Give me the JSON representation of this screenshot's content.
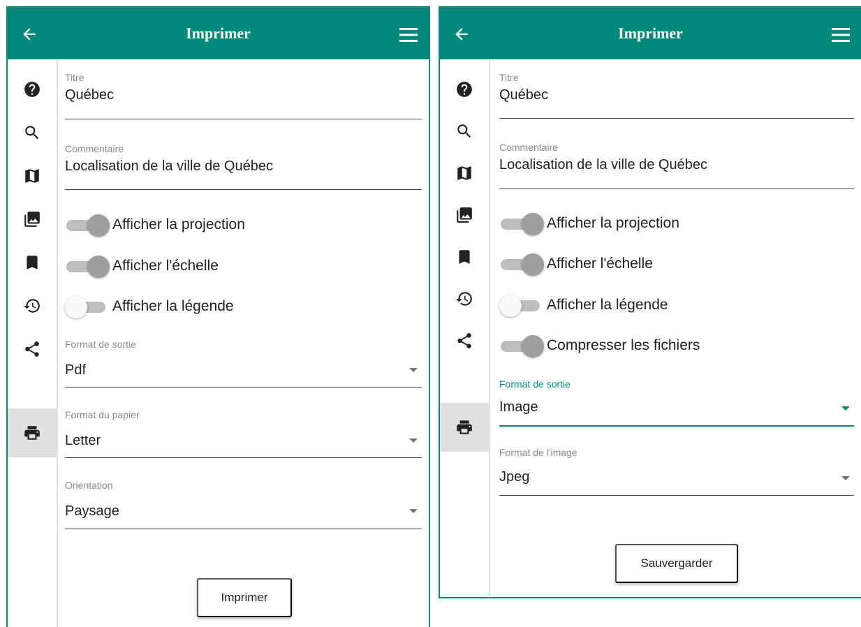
{
  "panel_a": {
    "header": {
      "title": "Imprimer",
      "back_icon": "arrow-back-icon",
      "menu_icon": "menu-icon"
    },
    "sidebar": [
      {
        "icon": "help-icon",
        "active": false
      },
      {
        "icon": "search-icon",
        "active": false
      },
      {
        "icon": "map-icon",
        "active": false
      },
      {
        "icon": "photo-library-icon",
        "active": false
      },
      {
        "icon": "bookmark-icon",
        "active": false
      },
      {
        "icon": "history-icon",
        "active": false
      },
      {
        "icon": "share-icon",
        "active": false
      },
      {
        "icon": "print-icon",
        "active": true
      }
    ],
    "titre": {
      "label": "Titre",
      "value": "Québec"
    },
    "commentaire": {
      "label": "Commentaire",
      "value": "Localisation de la ville de Québec"
    },
    "toggles": [
      {
        "label": "Afficher la projection",
        "on": true
      },
      {
        "label": "Afficher l'échelle",
        "on": true
      },
      {
        "label": "Afficher la légende",
        "on": false
      }
    ],
    "format_sortie": {
      "label": "Format de sortie",
      "value": "Pdf"
    },
    "format_papier": {
      "label": "Format du papier",
      "value": "Letter"
    },
    "orientation": {
      "label": "Orientation",
      "value": "Paysage"
    },
    "button": "Imprimer"
  },
  "panel_b": {
    "header": {
      "title": "Imprimer",
      "back_icon": "arrow-back-icon",
      "menu_icon": "menu-icon"
    },
    "sidebar": [
      {
        "icon": "help-icon",
        "active": false
      },
      {
        "icon": "search-icon",
        "active": false
      },
      {
        "icon": "map-icon",
        "active": false
      },
      {
        "icon": "photo-library-icon",
        "active": false
      },
      {
        "icon": "bookmark-icon",
        "active": false
      },
      {
        "icon": "history-icon",
        "active": false
      },
      {
        "icon": "share-icon",
        "active": false
      },
      {
        "icon": "print-icon",
        "active": true
      }
    ],
    "titre": {
      "label": "Titre",
      "value": "Québec"
    },
    "commentaire": {
      "label": "Commentaire",
      "value": "Localisation de la ville de Québec"
    },
    "toggles": [
      {
        "label": "Afficher la projection",
        "on": true
      },
      {
        "label": "Afficher l'échelle",
        "on": true
      },
      {
        "label": "Afficher la légende",
        "on": false
      },
      {
        "label": "Compresser les fichiers",
        "on": true
      }
    ],
    "format_sortie": {
      "label": "Format de sortie",
      "value": "Image"
    },
    "format_image": {
      "label": "Format de l'image",
      "value": "Jpeg"
    },
    "button": "Sauvergarder"
  },
  "colors": {
    "accent": "#00897b",
    "active_bg": "#e0e0e0",
    "text": "#222222",
    "label": "#8a8a8a"
  }
}
